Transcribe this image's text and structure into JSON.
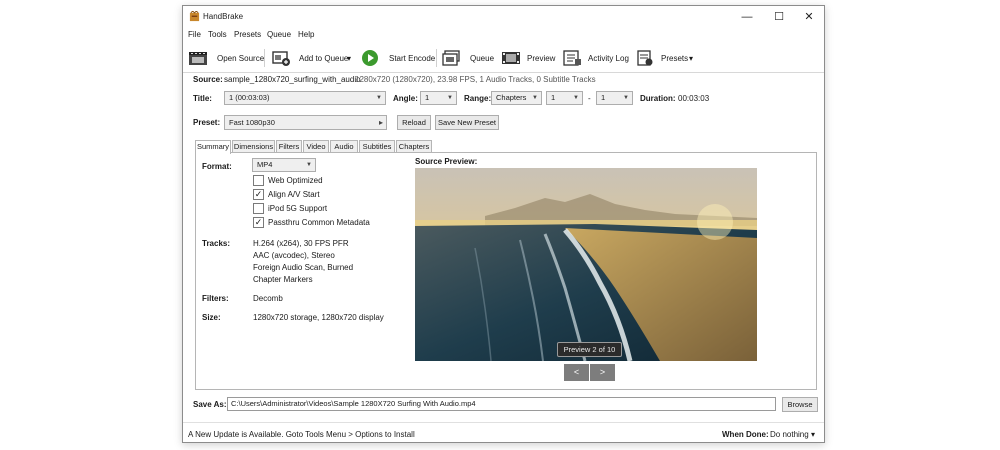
{
  "window": {
    "title": "HandBrake",
    "controls": {
      "minimize": "—",
      "maximize": "☐",
      "close": "✕"
    }
  },
  "menu": [
    "File",
    "Tools",
    "Presets",
    "Queue",
    "Help"
  ],
  "toolbar": {
    "open_source": "Open Source",
    "add_to_queue": "Add to Queue",
    "add_to_queue_arrow": "▾",
    "start_encode": "Start Encode",
    "queue": "Queue",
    "preview": "Preview",
    "activity_log": "Activity Log",
    "presets": "Presets",
    "presets_arrow": "▾"
  },
  "source": {
    "label": "Source:",
    "name": "sample_1280x720_surfing_with_audio",
    "info": "1280x720 (1280x720), 23.98 FPS, 1 Audio Tracks, 0 Subtitle Tracks"
  },
  "title_row": {
    "title_label": "Title:",
    "title_value": "1  (00:03:03)",
    "angle_label": "Angle:",
    "angle_value": "1",
    "range_label": "Range:",
    "range_type": "Chapters",
    "range_start": "1",
    "range_dash": "-",
    "range_end": "1",
    "duration_label": "Duration:",
    "duration_value": "00:03:03"
  },
  "preset": {
    "label": "Preset:",
    "value": "Fast 1080p30",
    "arrow": "▸",
    "reload": "Reload",
    "save_new": "Save New Preset"
  },
  "tabs": [
    "Summary",
    "Dimensions",
    "Filters",
    "Video",
    "Audio",
    "Subtitles",
    "Chapters"
  ],
  "active_tab": "Summary",
  "summary": {
    "format_label": "Format:",
    "format_value": "MP4",
    "options": [
      {
        "label": "Web Optimized",
        "checked": false
      },
      {
        "label": "Align A/V Start",
        "checked": true
      },
      {
        "label": "iPod 5G Support",
        "checked": false
      },
      {
        "label": "Passthru Common Metadata",
        "checked": true
      }
    ],
    "tracks_label": "Tracks:",
    "tracks": [
      "H.264 (x264), 30 FPS PFR",
      "AAC (avcodec), Stereo",
      "Foreign Audio Scan, Burned",
      "Chapter Markers"
    ],
    "filters_label": "Filters:",
    "filters_value": "Decomb",
    "size_label": "Size:",
    "size_value": "1280x720 storage, 1280x720 display",
    "source_preview_label": "Source Preview:",
    "preview_badge": "Preview 2 of 10",
    "prev": "<",
    "next": ">"
  },
  "save_as": {
    "label": "Save As:",
    "path": "C:\\Users\\Administrator\\Videos\\Sample 1280X720 Surfing With Audio.mp4",
    "browse": "Browse"
  },
  "status": {
    "message": "A New Update is Available. Goto Tools Menu > Options to Install",
    "when_done_label": "When Done:",
    "when_done_value": "Do nothing",
    "when_done_arrow": "▾"
  },
  "colors": {
    "start_green": "#3c9a2e",
    "nav_button": "#7d7d7d",
    "badge_bg": "#2b2b2b"
  }
}
